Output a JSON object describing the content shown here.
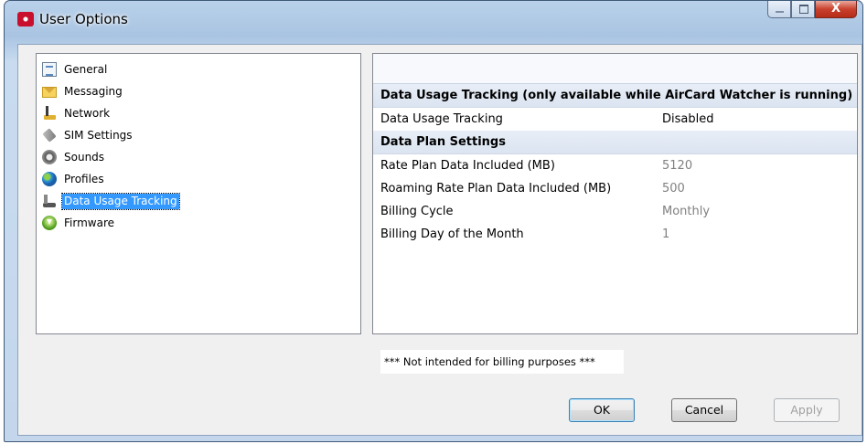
{
  "window": {
    "title": "User Options",
    "close_label": "X"
  },
  "tree": {
    "items": [
      {
        "label": "General",
        "icon": "general-icon"
      },
      {
        "label": "Messaging",
        "icon": "envelope-icon"
      },
      {
        "label": "Network",
        "icon": "network-icon"
      },
      {
        "label": "SIM Settings",
        "icon": "sim-card-icon"
      },
      {
        "label": "Sounds",
        "icon": "speaker-icon"
      },
      {
        "label": "Profiles",
        "icon": "globe-icon"
      },
      {
        "label": "Data Usage Tracking",
        "icon": "data-usage-icon",
        "selected": true
      },
      {
        "label": "Firmware",
        "icon": "download-icon"
      }
    ]
  },
  "properties": {
    "section1": "Data Usage Tracking (only available while AirCard Watcher is running)",
    "tracking_name": "Data Usage Tracking",
    "tracking_value": "Disabled",
    "section2": "Data Plan Settings",
    "rows": [
      {
        "name": "Rate Plan Data Included (MB)",
        "value": "5120"
      },
      {
        "name": "Roaming Rate Plan Data Included (MB)",
        "value": "500"
      },
      {
        "name": "Billing Cycle",
        "value": "Monthly"
      },
      {
        "name": "Billing Day of the Month",
        "value": "1"
      }
    ]
  },
  "footer_note": "*** Not intended for billing purposes ***",
  "buttons": {
    "ok": "OK",
    "cancel": "Cancel",
    "apply": "Apply"
  }
}
